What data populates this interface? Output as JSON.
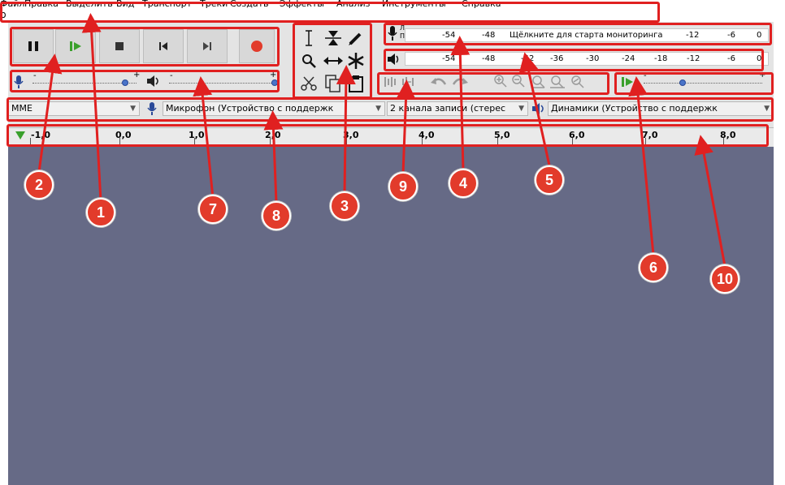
{
  "menu": {
    "items": [
      "Файл",
      "Правка",
      "Выделить",
      "Вид",
      "Транспорт",
      "Треки",
      "Создать",
      "Эффекты",
      "Анализ",
      "Инструменты",
      "Справка"
    ],
    "overflow_text": "р"
  },
  "meters": {
    "record_hint": "Щёлкните для старта мониторинга",
    "record_ticks": [
      "-54",
      "-48",
      "-12",
      "-6",
      "0"
    ],
    "play_ticks": [
      "-54",
      "-48",
      "-42",
      "-36",
      "-30",
      "-24",
      "-18",
      "-12",
      "-6",
      "0"
    ],
    "channel_letters": [
      "Л",
      "П"
    ]
  },
  "sliders": {
    "recording_min": "-",
    "recording_max": "+",
    "playback_min": "-",
    "playback_max": "+",
    "speed_min": "-",
    "speed_max": "+",
    "recording_level": 0.89,
    "playback_level": 1.0,
    "speed_level": 0.33
  },
  "devices": {
    "host": "MME",
    "input_device": "Микрофон (Устройство с поддержк",
    "channels": "2 канала записи (стерес",
    "output_device": "Динамики (Устройство с поддержк"
  },
  "timeline": {
    "labels": [
      "-1,0",
      "0,0",
      "1,0",
      "2,0",
      "3,0",
      "4,0",
      "5,0",
      "6,0",
      "7,0",
      "8,0"
    ]
  },
  "markers": [
    "1",
    "2",
    "3",
    "4",
    "5",
    "6",
    "7",
    "8",
    "9",
    "10"
  ],
  "colors": {
    "annotation_red": "#e02020",
    "marker_red": "#e23b2b",
    "track_bg": "#666a86",
    "record_red": "#e23b2b",
    "play_green": "#3aa02c",
    "knob_blue": "#4a74c9"
  }
}
